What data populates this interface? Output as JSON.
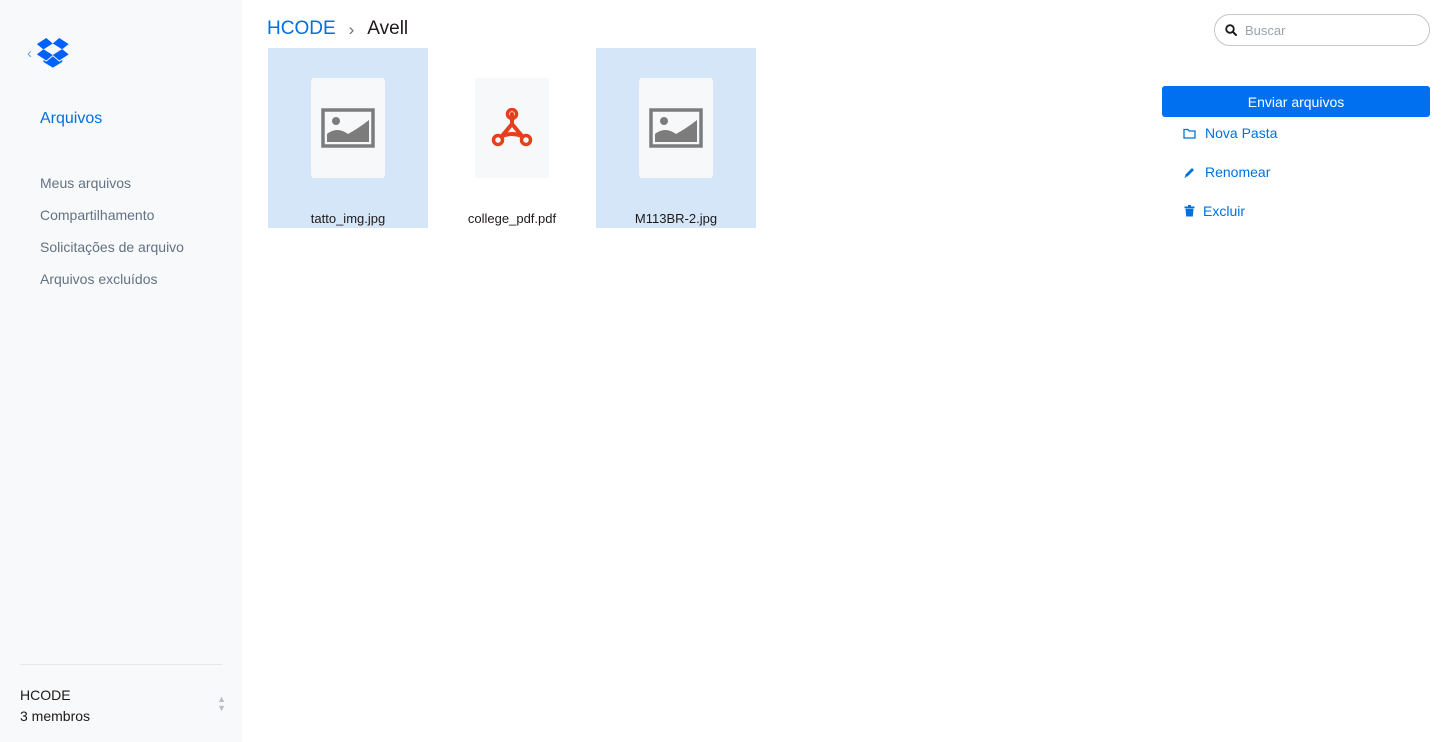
{
  "sidebar": {
    "section_title": "Arquivos",
    "items": [
      {
        "label": "Meus arquivos"
      },
      {
        "label": "Compartilhamento"
      },
      {
        "label": "Solicitações de arquivo"
      },
      {
        "label": "Arquivos excluídos"
      }
    ],
    "team": {
      "name": "HCODE",
      "members": "3 membros"
    }
  },
  "breadcrumb": {
    "root": "HCODE",
    "current": "Avell"
  },
  "search": {
    "placeholder": "Buscar"
  },
  "files": [
    {
      "name": "tatto_img.jpg",
      "type": "image",
      "icon": "image-icon",
      "selected": true
    },
    {
      "name": "college_pdf.pdf",
      "type": "pdf",
      "icon": "pdf-icon",
      "selected": false
    },
    {
      "name": "M113BR-2.jpg",
      "type": "image",
      "icon": "image-icon",
      "selected": true
    }
  ],
  "actions": {
    "upload_label": "Enviar arquivos",
    "new_folder_label": "Nova Pasta",
    "rename_label": "Renomear",
    "delete_label": "Excluir"
  },
  "colors": {
    "accent": "#0070e0",
    "button": "#0070f0",
    "selected_bg": "#d5e6f8",
    "pdf_icon": "#e4401c",
    "sidebar_bg": "#f7f9fa"
  }
}
